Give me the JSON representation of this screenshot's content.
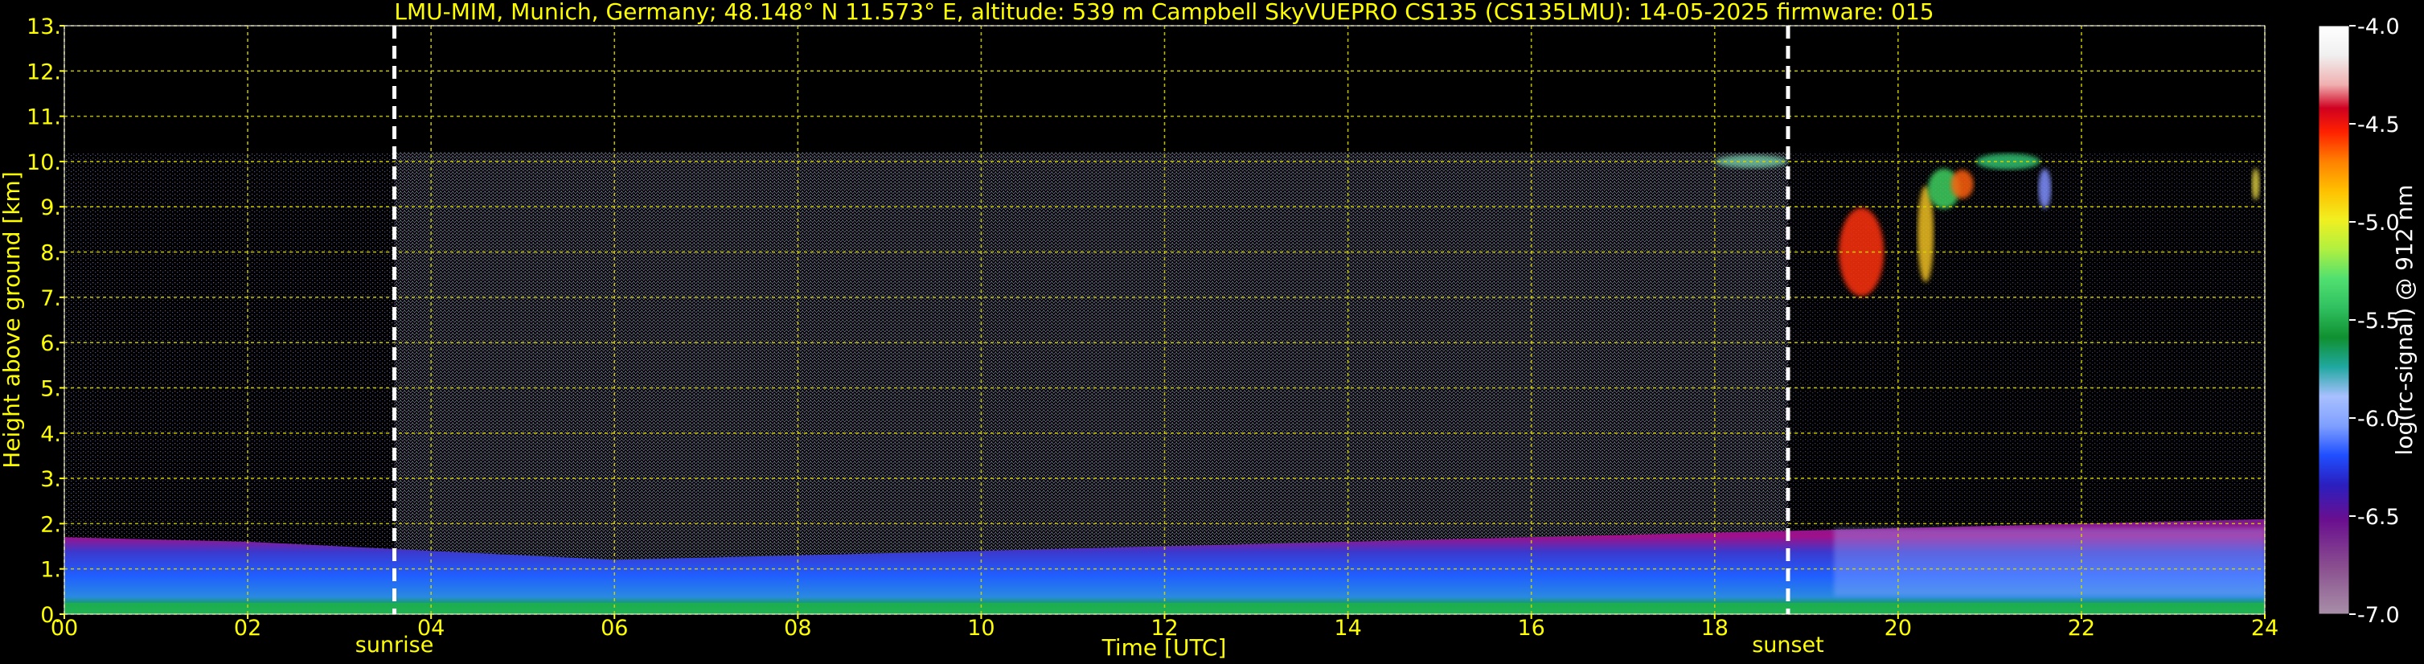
{
  "chart_data": {
    "type": "heatmap",
    "title": "LMU-MIM, Munich, Germany; 48.148° N 11.573° E, altitude: 539 m    Campbell SkyVUEPRO CS135 (CS135LMU): 14-05-2025    firmware: 015",
    "xlabel": "Time [UTC]",
    "ylabel": "Height above ground [km]",
    "xlim": [
      0,
      24
    ],
    "ylim": [
      0,
      13
    ],
    "x_ticks": [
      "00",
      "02",
      "04",
      "06",
      "08",
      "10",
      "12",
      "14",
      "16",
      "18",
      "20",
      "22",
      "24"
    ],
    "y_ticks": [
      "0.",
      "1.",
      "2.",
      "3.",
      "4.",
      "5.",
      "6.",
      "7.",
      "8.",
      "9.",
      "10.",
      "11.",
      "12.",
      "13."
    ],
    "grid": true,
    "max_range_km": 10.2,
    "markers": [
      {
        "label": "sunrise",
        "x": 3.6
      },
      {
        "label": "sunset",
        "x": 18.8
      }
    ],
    "colorbar": {
      "label": "log(rc-signal) @ 912 nm",
      "range": [
        -7.0,
        -4.0
      ],
      "ticks": [
        "-4.0",
        "-4.5",
        "-5.0",
        "-5.5",
        "-6.0",
        "-6.5",
        "-7.0"
      ],
      "placement": "right"
    },
    "features": [
      {
        "name": "boundary layer",
        "x_start": 0,
        "x_end": 24,
        "top_km": [
          1.7,
          1.6,
          1.4,
          1.2,
          1.3,
          1.4,
          1.5,
          1.6,
          1.7,
          1.8,
          1.9,
          2.0,
          2.1
        ]
      },
      {
        "name": "cirrus",
        "x_start": 19.3,
        "x_end": 21.7,
        "y_range_km": [
          7.5,
          10.2
        ]
      }
    ]
  }
}
